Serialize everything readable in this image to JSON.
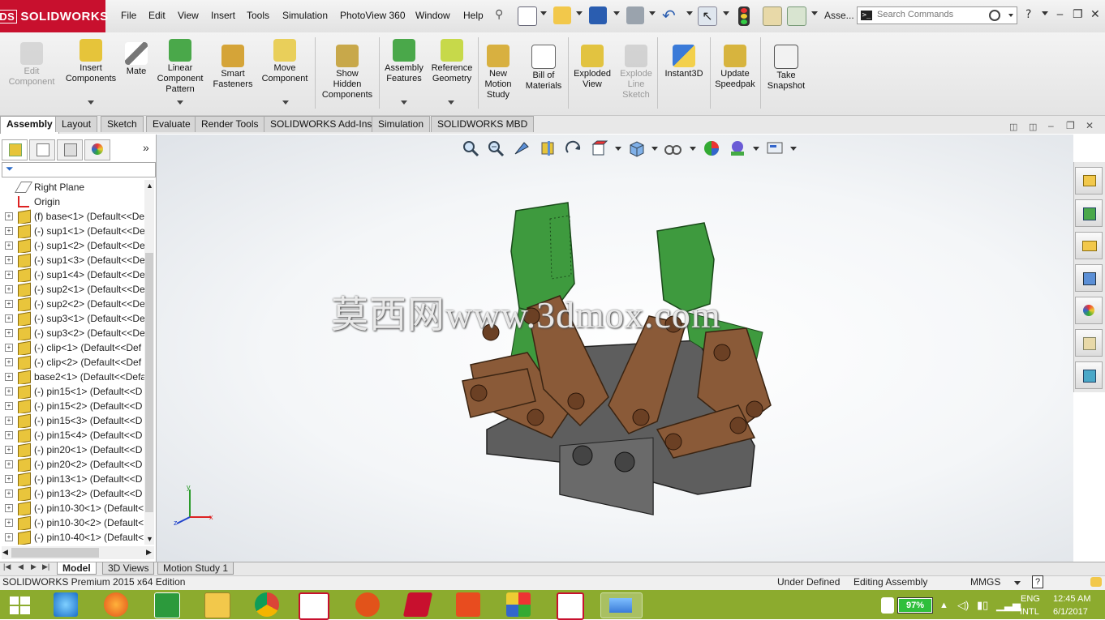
{
  "app": {
    "brand": "SOLIDWORKS",
    "brand_prefix": "DS",
    "accent": "#c8102e"
  },
  "menu": [
    "File",
    "Edit",
    "View",
    "Insert",
    "Tools",
    "Simulation",
    "PhotoView 360",
    "Window",
    "Help"
  ],
  "quick_access": {
    "doc_name": "Asse...",
    "search_placeholder": "Search Commands",
    "help": "?"
  },
  "ribbon": {
    "buttons": [
      {
        "label": "Edit\nComponent",
        "icon": "edit-component-icon",
        "disabled": true
      },
      {
        "label": "Insert\nComponents",
        "icon": "insert-components-icon",
        "disabled": false
      },
      {
        "label": "Mate",
        "icon": "mate-icon",
        "disabled": false
      },
      {
        "label": "Linear\nComponent\nPattern",
        "icon": "linear-pattern-icon",
        "disabled": false
      },
      {
        "label": "Smart\nFasteners",
        "icon": "smart-fasteners-icon",
        "disabled": false
      },
      {
        "label": "Move\nComponent",
        "icon": "move-component-icon",
        "disabled": false
      },
      {
        "label": "Show\nHidden\nComponents",
        "icon": "show-hidden-icon",
        "disabled": false
      },
      {
        "label": "Assembly\nFeatures",
        "icon": "assembly-features-icon",
        "disabled": false
      },
      {
        "label": "Reference\nGeometry",
        "icon": "reference-geometry-icon",
        "disabled": false
      },
      {
        "label": "New\nMotion\nStudy",
        "icon": "motion-study-icon",
        "disabled": false
      },
      {
        "label": "Bill of\nMaterials",
        "icon": "bom-icon",
        "disabled": false
      },
      {
        "label": "Exploded\nView",
        "icon": "exploded-view-icon",
        "disabled": false
      },
      {
        "label": "Explode\nLine\nSketch",
        "icon": "explode-line-icon",
        "disabled": true
      },
      {
        "label": "Instant3D",
        "icon": "instant3d-icon",
        "disabled": false
      },
      {
        "label": "Update\nSpeedpak",
        "icon": "speedpak-icon",
        "disabled": false
      },
      {
        "label": "Take\nSnapshot",
        "icon": "snapshot-icon",
        "disabled": false
      }
    ]
  },
  "command_tabs": [
    "Assembly",
    "Layout",
    "Sketch",
    "Evaluate",
    "Render Tools",
    "SOLIDWORKS Add-Ins",
    "Simulation",
    "SOLIDWORKS MBD"
  ],
  "feature_tree": {
    "rows": [
      {
        "label": "Right Plane",
        "type": "plane"
      },
      {
        "label": "Origin",
        "type": "origin"
      },
      {
        "label": "(f) base<1> (Default<<De",
        "type": "part"
      },
      {
        "label": "(-) sup1<1> (Default<<De",
        "type": "part"
      },
      {
        "label": "(-) sup1<2> (Default<<De",
        "type": "part"
      },
      {
        "label": "(-) sup1<3> (Default<<De",
        "type": "part"
      },
      {
        "label": "(-) sup1<4> (Default<<De",
        "type": "part"
      },
      {
        "label": "(-) sup2<1> (Default<<De",
        "type": "part"
      },
      {
        "label": "(-) sup2<2> (Default<<De",
        "type": "part"
      },
      {
        "label": "(-) sup3<1> (Default<<De",
        "type": "part"
      },
      {
        "label": "(-) sup3<2> (Default<<De",
        "type": "part"
      },
      {
        "label": "(-) clip<1> (Default<<Def",
        "type": "part"
      },
      {
        "label": "(-) clip<2> (Default<<Def",
        "type": "part"
      },
      {
        "label": "base2<1> (Default<<Defa",
        "type": "part"
      },
      {
        "label": "(-) pin15<1> (Default<<D",
        "type": "part"
      },
      {
        "label": "(-) pin15<2> (Default<<D",
        "type": "part"
      },
      {
        "label": "(-) pin15<3> (Default<<D",
        "type": "part"
      },
      {
        "label": "(-) pin15<4> (Default<<D",
        "type": "part"
      },
      {
        "label": "(-) pin20<1> (Default<<D",
        "type": "part"
      },
      {
        "label": "(-) pin20<2> (Default<<D",
        "type": "part"
      },
      {
        "label": "(-) pin13<1> (Default<<D",
        "type": "part"
      },
      {
        "label": "(-) pin13<2> (Default<<D",
        "type": "part"
      },
      {
        "label": "(-) pin10-30<1> (Default<",
        "type": "part"
      },
      {
        "label": "(-) pin10-30<2> (Default<",
        "type": "part"
      },
      {
        "label": "(-) pin10-40<1> (Default<",
        "type": "part"
      }
    ]
  },
  "watermark": "莫西网www.3dmox.com",
  "triad": {
    "x": "x",
    "y": "y",
    "z": "z"
  },
  "bottom_tabs": [
    "Model",
    "3D Views",
    "Motion Study 1"
  ],
  "status": {
    "edition": "SOLIDWORKS Premium 2015 x64 Edition",
    "definition": "Under Defined",
    "mode": "Editing Assembly",
    "units": "MMGS",
    "help": "?"
  },
  "taskbar": {
    "battery": "97%",
    "lang1": "ENG",
    "lang2": "INTL",
    "time": "12:45 AM",
    "date": "6/1/2017",
    "color": "#8cab2e"
  },
  "colors": {
    "green_part": "#3e9a3e",
    "bronze_part": "#8a5a38",
    "gray_part": "#5e5e5e"
  }
}
